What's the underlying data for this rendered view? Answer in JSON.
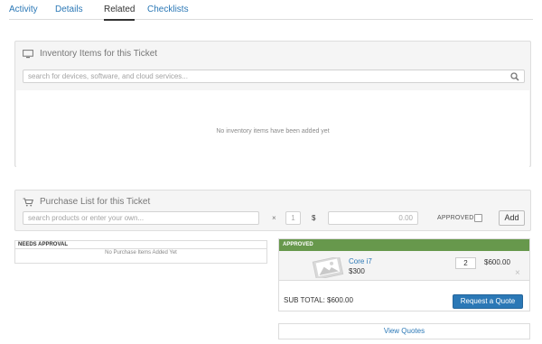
{
  "tabs": [
    {
      "label": "Activity",
      "active": false
    },
    {
      "label": "Details",
      "active": false
    },
    {
      "label": "Related",
      "active": true
    },
    {
      "label": "Checklists",
      "active": false
    }
  ],
  "inventory": {
    "title": "Inventory Items for this Ticket",
    "search_placeholder": "search for devices, software, and cloud services...",
    "empty_message": "No inventory items have been added yet",
    "icon": "monitor-icon"
  },
  "purchase": {
    "title": "Purchase List for this Ticket",
    "search_placeholder": "search products or enter your own...",
    "multiply": "×",
    "qty": "1",
    "currency": "$",
    "price": "0.00",
    "approved_label": "APPROVED",
    "add_label": "Add",
    "icon": "cart-icon"
  },
  "needs_approval": {
    "header": "NEEDS APPROVAL",
    "empty": "No Purchase Items Added Yet"
  },
  "approved": {
    "header": "APPROVED",
    "items": [
      {
        "name": "Core i7",
        "price": "$300",
        "qty": "2",
        "total": "$600.00"
      }
    ],
    "remove_glyph": "×",
    "subtotal": "SUB TOTAL: $600.00",
    "quote_label": "Request a Quote",
    "accent": "#67984c"
  },
  "view_quotes": "View Quotes",
  "colors": {
    "link": "#2b78b6",
    "approved_green": "#67984c",
    "panel_bg": "#f5f5f5"
  }
}
